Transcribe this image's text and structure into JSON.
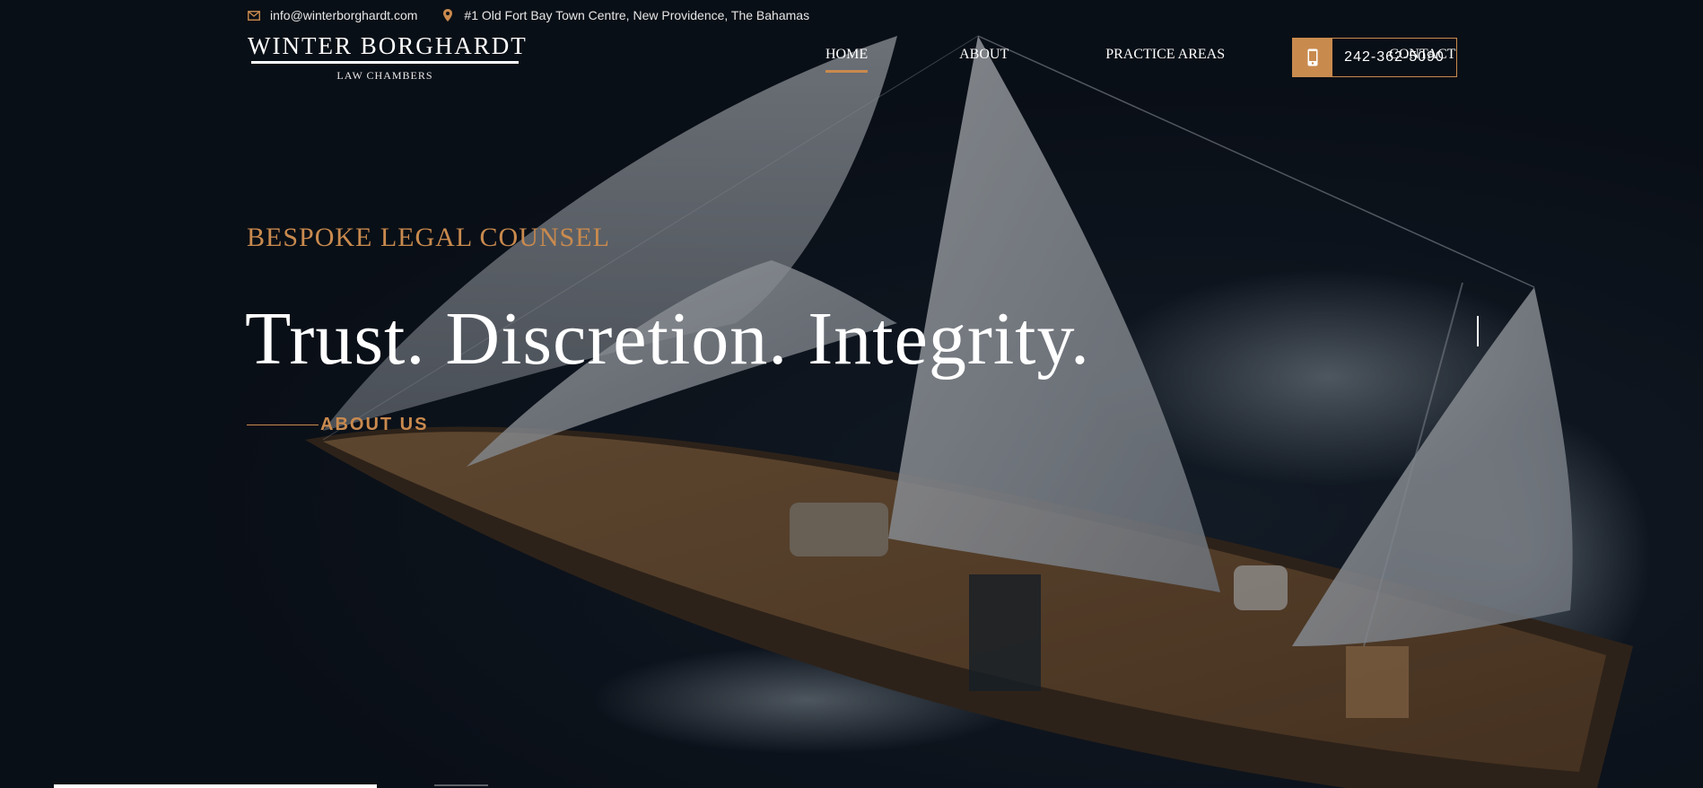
{
  "topbar": {
    "email": "info@winterborghardt.com",
    "address": "#1 Old Fort Bay Town Centre, New Providence, The Bahamas",
    "email_icon": "mail-icon",
    "address_icon": "map-pin-icon"
  },
  "logo": {
    "name_first": "WINTER",
    "name_second": "BORGHARDT",
    "subtitle": "LAW CHAMBERS"
  },
  "nav": {
    "items": [
      {
        "label": "HOME",
        "active": true
      },
      {
        "label": "ABOUT",
        "active": false
      },
      {
        "label": "PRACTICE AREAS",
        "active": false
      },
      {
        "label": "CONTACT",
        "active": false
      }
    ]
  },
  "phone": {
    "number": "242-362-5090",
    "icon": "mobile-phone-icon"
  },
  "hero": {
    "eyebrow": "BESPOKE LEGAL COUNSEL",
    "headline": "Trust. Discretion. Integrity.",
    "cta_label": "ABOUT US"
  },
  "colors": {
    "accent": "#c98a4e",
    "text": "#ffffff",
    "background": "#0b1119"
  }
}
